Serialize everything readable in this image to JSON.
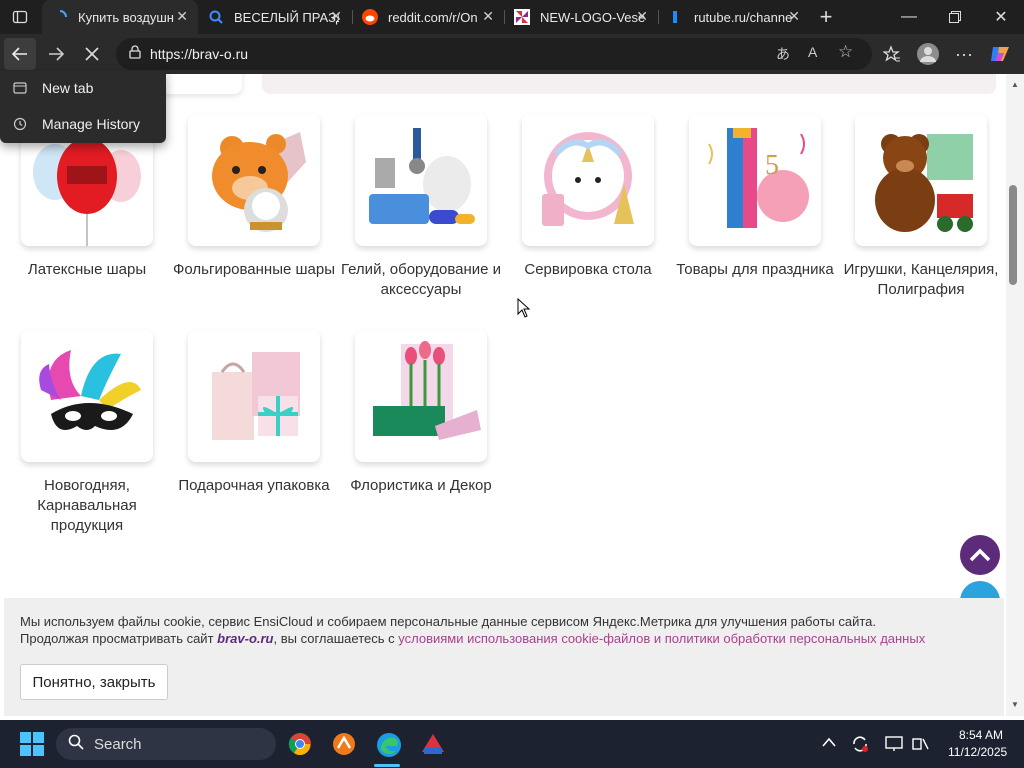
{
  "browser": {
    "tabs": [
      {
        "title": "Купить воздушн",
        "active": true,
        "favicon": "loading-spinner-icon"
      },
      {
        "title": "ВЕСЕЛЫЙ ПРАЗД",
        "favicon": "search-icon"
      },
      {
        "title": "reddit.com/r/On",
        "favicon": "reddit-icon"
      },
      {
        "title": "NEW-LOGO-Vese",
        "favicon": "pinwheel-icon"
      },
      {
        "title": "rutube.ru/channe",
        "favicon": "rutube-icon"
      }
    ],
    "url": "https://brav-o.ru"
  },
  "history_menu": {
    "items": [
      {
        "label": "New tab",
        "icon": "tab-icon"
      },
      {
        "label": "Manage History",
        "icon": "history-icon"
      }
    ]
  },
  "categories": [
    {
      "label": "Латексные шары"
    },
    {
      "label": "Фольгированные шары"
    },
    {
      "label": "Гелий, оборудование и аксессуары"
    },
    {
      "label": "Сервировка стола"
    },
    {
      "label": "Товары для праздника"
    },
    {
      "label": "Игрушки, Канцелярия, Полиграфия"
    },
    {
      "label": "Новогодняя, Карнавальная продукция"
    },
    {
      "label": "Подарочная упаковка"
    },
    {
      "label": "Флористика и Декор"
    }
  ],
  "cookie_banner": {
    "line1": "Мы используем файлы cookie, сервис EnsiCloud и собираем персональные данные сервисом Яндекс.Метрика для улучшения работы сайта.",
    "line2_prefix": "Продолжая просматривать сайт",
    "brand": "brav-o.ru",
    "line2_middle": ", вы соглашаетесь с",
    "link_text": "условиями использования cookie-файлов и политики обработки персональных данных",
    "button": "Понятно, закрыть"
  },
  "taskbar": {
    "search_placeholder": "Search",
    "time": "8:54 AM",
    "date": "11/12/2025"
  },
  "colors": {
    "brand_purple": "#5c2b7a",
    "link_pink": "#a7438e",
    "telegram_blue": "#2aa3df"
  }
}
